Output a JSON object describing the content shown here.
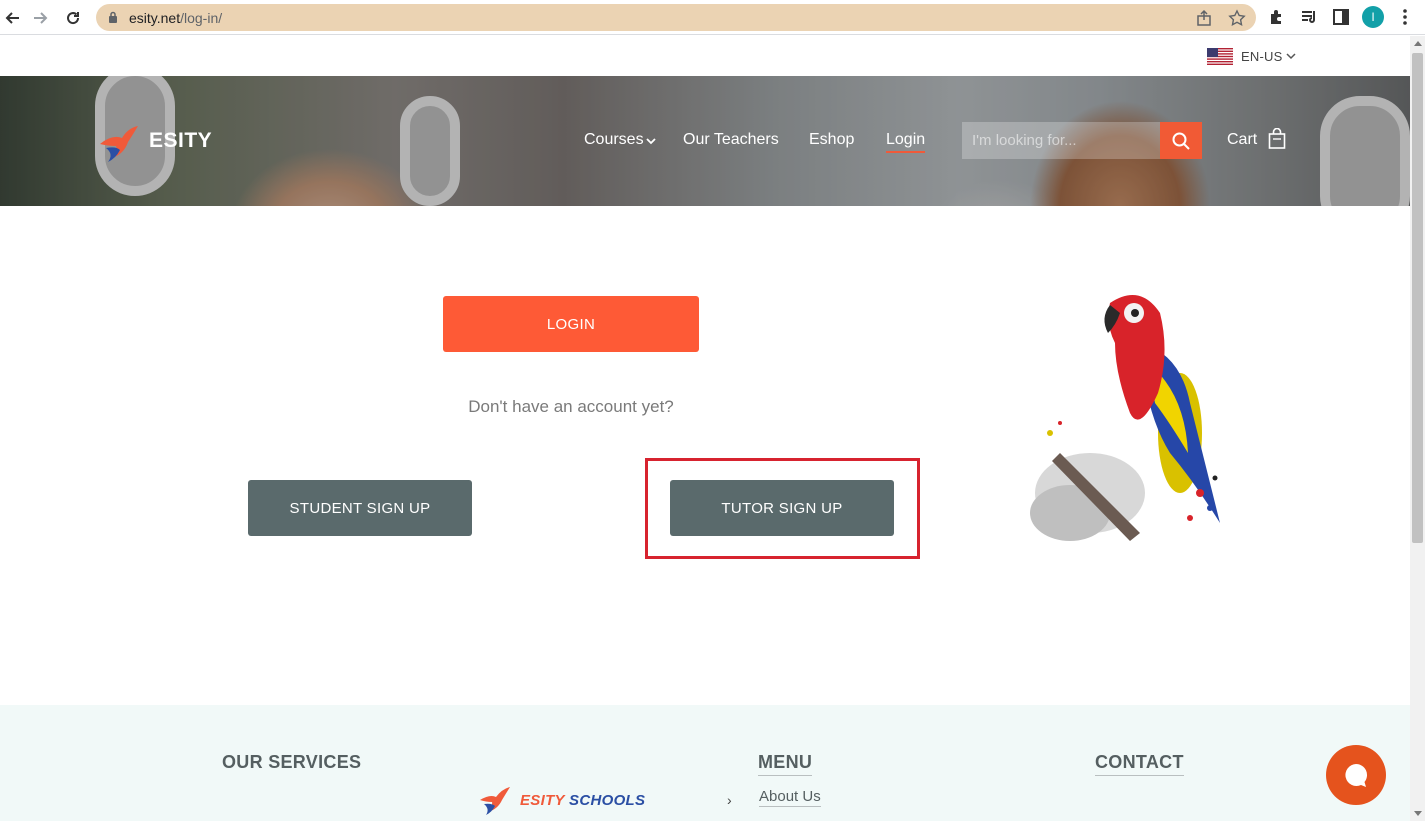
{
  "browser": {
    "url_host": "esity.net",
    "url_path": "/log-in/",
    "profile_initial": "I"
  },
  "header": {
    "language": "EN-US",
    "brand": "ESITY",
    "menu": {
      "courses": "Courses",
      "teachers": "Our Teachers",
      "eshop": "Eshop",
      "login": "Login"
    },
    "search_placeholder": "I'm looking for...",
    "cart": "Cart"
  },
  "main": {
    "login_button": "LOGIN",
    "no_account_text": "Don't have an account yet?",
    "student_signup": "STUDENT SIGN UP",
    "tutor_signup": "TUTOR SIGN UP"
  },
  "footer": {
    "services_heading": "OUR SERVICES",
    "menu_heading": "MENU",
    "contact_heading": "CONTACT",
    "schools_logo_part1": "ESITY",
    "schools_logo_part2": "SCHOOLS",
    "about_link": "About Us"
  },
  "colors": {
    "accent": "#fe5a36",
    "button_dark": "#5a6a6c",
    "highlight": "#d7232f",
    "url_bar": "#ebd3b3"
  }
}
